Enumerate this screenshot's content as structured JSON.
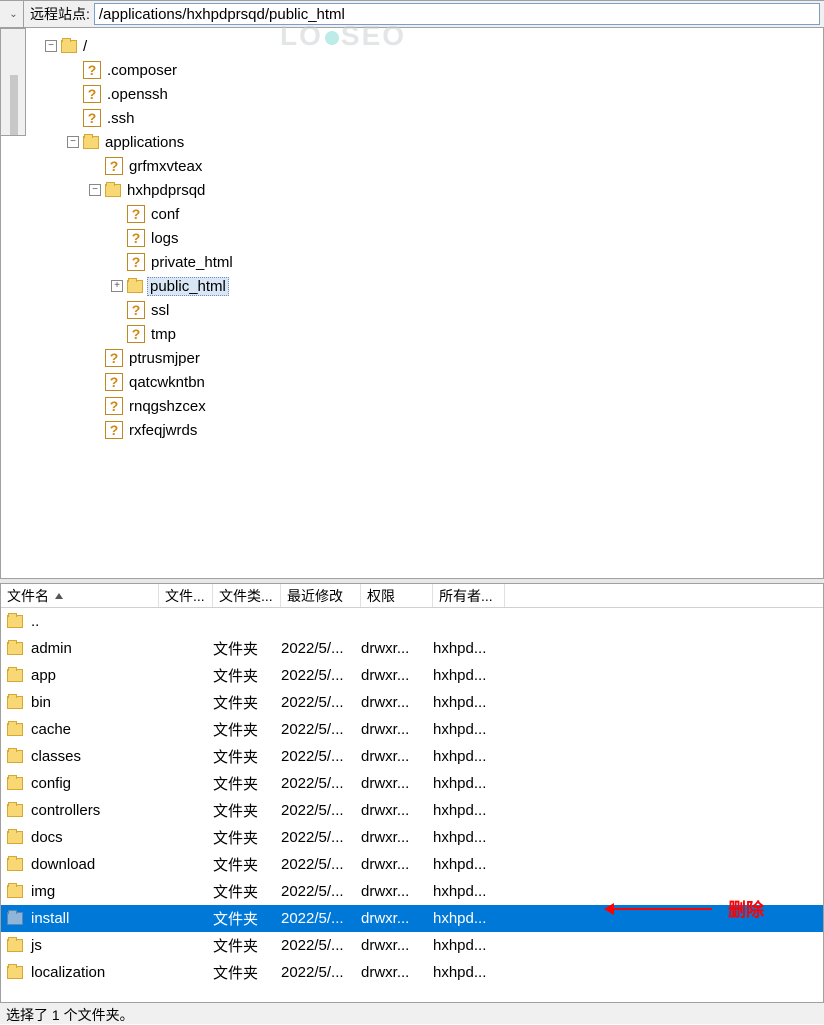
{
  "watermark": "LO SEO",
  "toolbar": {
    "label": "远程站点:",
    "path": "/applications/hxhpdprsqd/public_html"
  },
  "tree": {
    "root": "/",
    "nodes": [
      {
        "level": 1,
        "icon": "q",
        "label": ".composer"
      },
      {
        "level": 1,
        "icon": "q",
        "label": ".openssh"
      },
      {
        "level": 1,
        "icon": "q",
        "label": ".ssh"
      },
      {
        "level": 1,
        "icon": "folder",
        "toggle": "-",
        "label": "applications"
      },
      {
        "level": 2,
        "icon": "q",
        "label": "grfmxvteax"
      },
      {
        "level": 2,
        "icon": "folder",
        "toggle": "-",
        "label": "hxhpdprsqd"
      },
      {
        "level": 3,
        "icon": "q",
        "label": "conf"
      },
      {
        "level": 3,
        "icon": "q",
        "label": "logs"
      },
      {
        "level": 3,
        "icon": "q",
        "label": "private_html"
      },
      {
        "level": 3,
        "icon": "folder",
        "toggle": "+",
        "label": "public_html",
        "selected": true
      },
      {
        "level": 3,
        "icon": "q",
        "label": "ssl"
      },
      {
        "level": 3,
        "icon": "q",
        "label": "tmp"
      },
      {
        "level": 2,
        "icon": "q",
        "label": "ptrusmjper"
      },
      {
        "level": 2,
        "icon": "q",
        "label": "qatcwkntbn"
      },
      {
        "level": 2,
        "icon": "q",
        "label": "rnqgshzcex"
      },
      {
        "level": 2,
        "icon": "q",
        "label": "rxfeqjwrds"
      }
    ]
  },
  "list": {
    "headers": {
      "name": "文件名",
      "size": "文件...",
      "type": "文件类...",
      "date": "最近修改",
      "perm": "权限",
      "owner": "所有者..."
    },
    "rows": [
      {
        "name": "..",
        "type": "",
        "date": "",
        "perm": "",
        "owner": "",
        "up": true
      },
      {
        "name": "admin",
        "type": "文件夹",
        "date": "2022/5/...",
        "perm": "drwxr...",
        "owner": "hxhpd..."
      },
      {
        "name": "app",
        "type": "文件夹",
        "date": "2022/5/...",
        "perm": "drwxr...",
        "owner": "hxhpd..."
      },
      {
        "name": "bin",
        "type": "文件夹",
        "date": "2022/5/...",
        "perm": "drwxr...",
        "owner": "hxhpd..."
      },
      {
        "name": "cache",
        "type": "文件夹",
        "date": "2022/5/...",
        "perm": "drwxr...",
        "owner": "hxhpd..."
      },
      {
        "name": "classes",
        "type": "文件夹",
        "date": "2022/5/...",
        "perm": "drwxr...",
        "owner": "hxhpd..."
      },
      {
        "name": "config",
        "type": "文件夹",
        "date": "2022/5/...",
        "perm": "drwxr...",
        "owner": "hxhpd..."
      },
      {
        "name": "controllers",
        "type": "文件夹",
        "date": "2022/5/...",
        "perm": "drwxr...",
        "owner": "hxhpd..."
      },
      {
        "name": "docs",
        "type": "文件夹",
        "date": "2022/5/...",
        "perm": "drwxr...",
        "owner": "hxhpd..."
      },
      {
        "name": "download",
        "type": "文件夹",
        "date": "2022/5/...",
        "perm": "drwxr...",
        "owner": "hxhpd..."
      },
      {
        "name": "img",
        "type": "文件夹",
        "date": "2022/5/...",
        "perm": "drwxr...",
        "owner": "hxhpd..."
      },
      {
        "name": "install",
        "type": "文件夹",
        "date": "2022/5/...",
        "perm": "drwxr...",
        "owner": "hxhpd...",
        "selected": true
      },
      {
        "name": "js",
        "type": "文件夹",
        "date": "2022/5/...",
        "perm": "drwxr...",
        "owner": "hxhpd..."
      },
      {
        "name": "localization",
        "type": "文件夹",
        "date": "2022/5/...",
        "perm": "drwxr...",
        "owner": "hxhpd..."
      }
    ]
  },
  "status": "选择了 1 个文件夹。",
  "annotation": "删除"
}
